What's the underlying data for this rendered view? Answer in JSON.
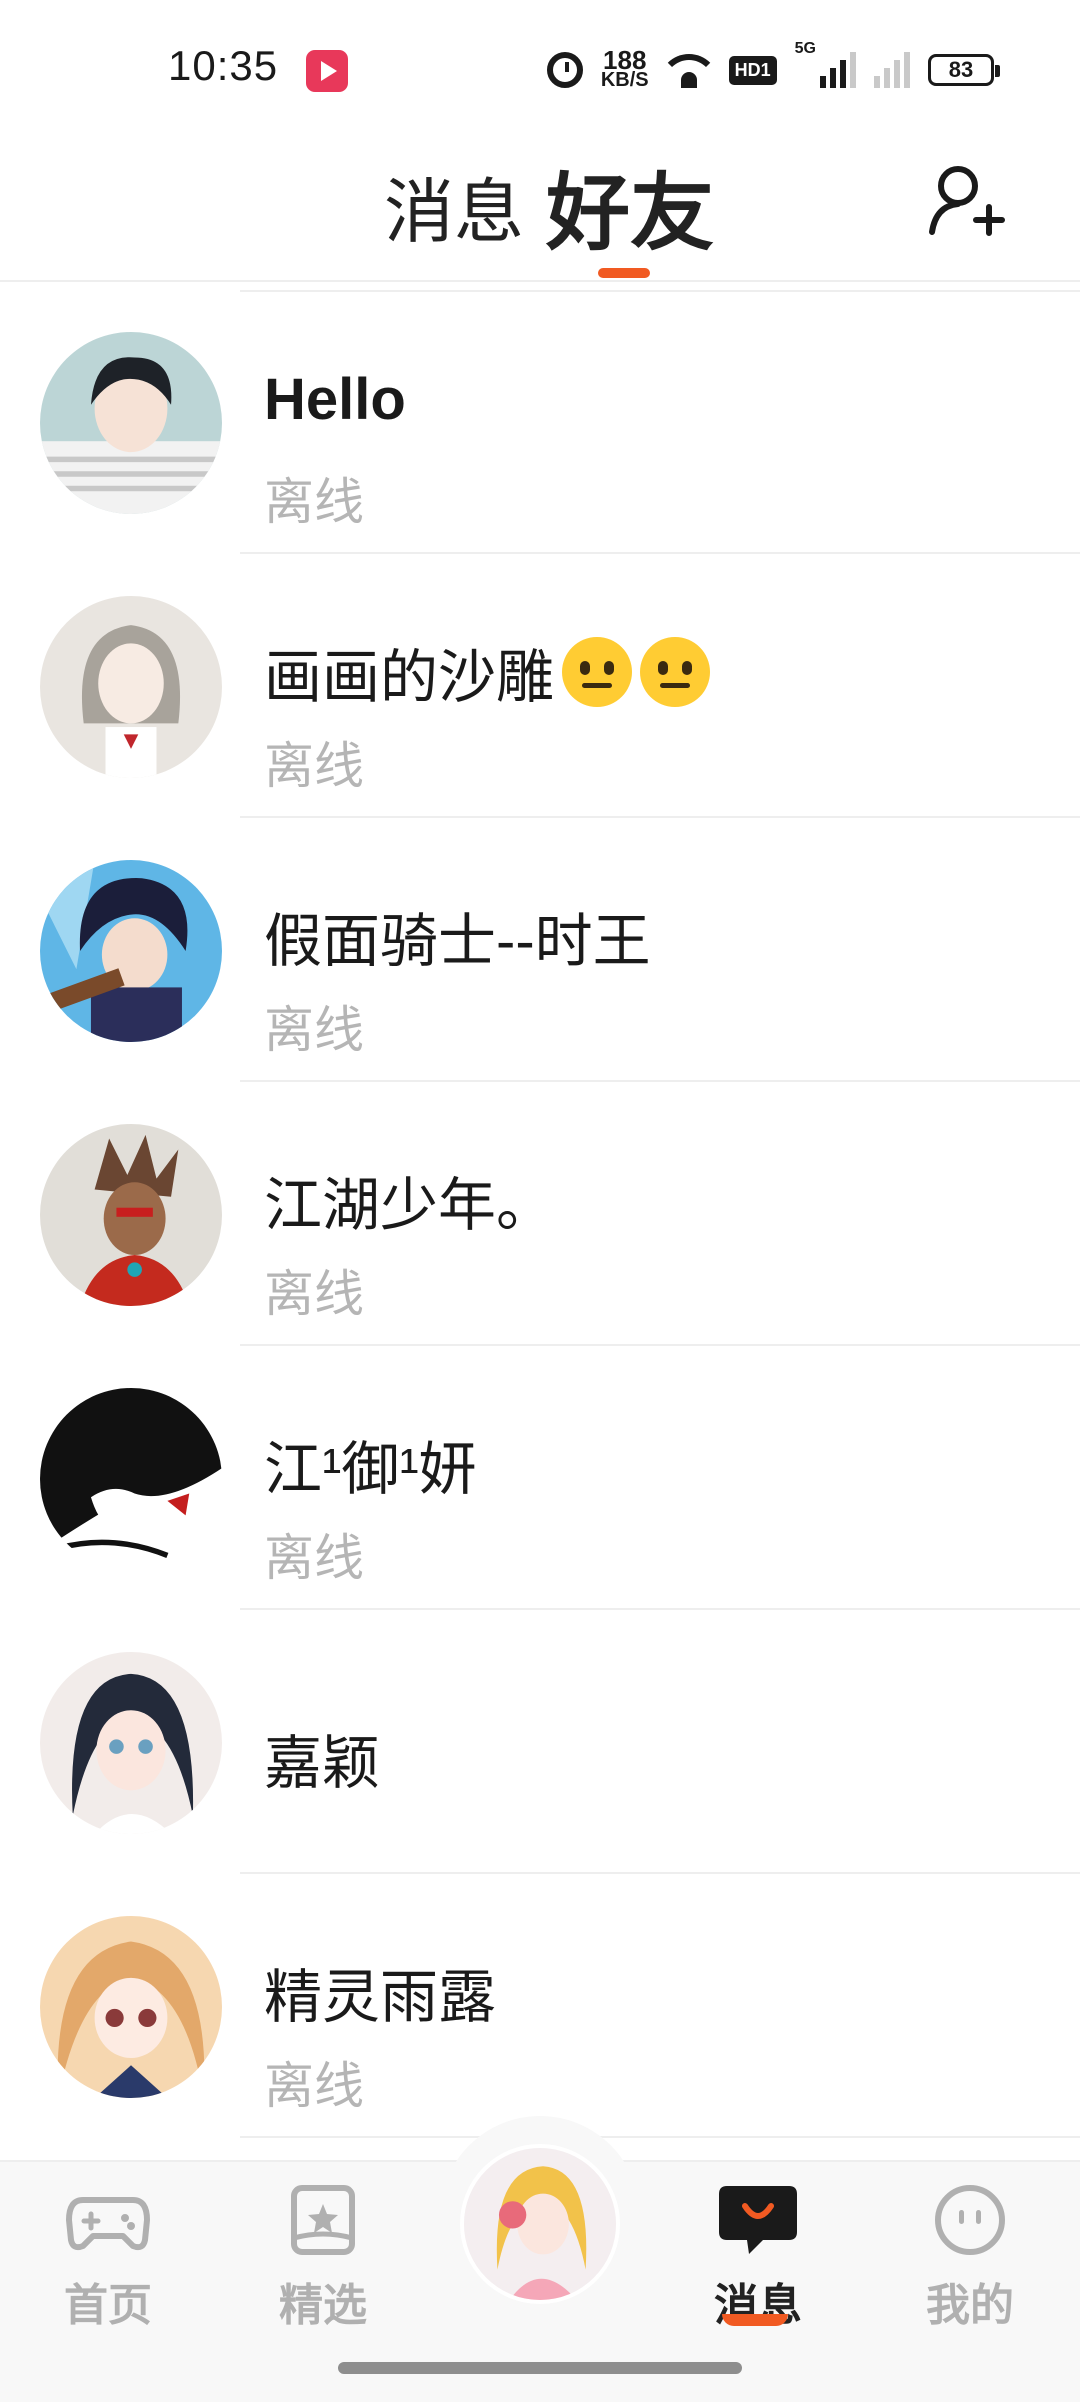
{
  "status_bar": {
    "time": "10:35",
    "net_speed_value": "188",
    "net_speed_unit": "KB/S",
    "hd_label": "HD1",
    "signal_label": "5G",
    "battery": "83"
  },
  "header": {
    "tab_messages": "消息",
    "tab_friends": "好友",
    "active_tab": "好友",
    "add_friend_icon": "add-user-icon",
    "accent_color": "#f15a22"
  },
  "friends": [
    {
      "name": "Hello",
      "status": "离线"
    },
    {
      "name": "画画的沙雕",
      "status": "离线",
      "emoji": "neutral-face x2"
    },
    {
      "name": "假面骑士--时王",
      "status": "离线"
    },
    {
      "name": "江湖少年。",
      "status": "离线"
    },
    {
      "name": "江¹御¹妍",
      "status": "离线"
    },
    {
      "name": "嘉颖"
    },
    {
      "name": "精灵雨露",
      "status": "离线"
    }
  ],
  "bottom_nav": {
    "items": [
      {
        "label": "首页",
        "icon": "gamepad-icon"
      },
      {
        "label": "精选",
        "icon": "star-card-icon"
      },
      {
        "label": "消息",
        "icon": "chat-bubble-icon",
        "active": true
      },
      {
        "label": "我的",
        "icon": "face-icon"
      }
    ],
    "center_button": "profile-avatar"
  }
}
